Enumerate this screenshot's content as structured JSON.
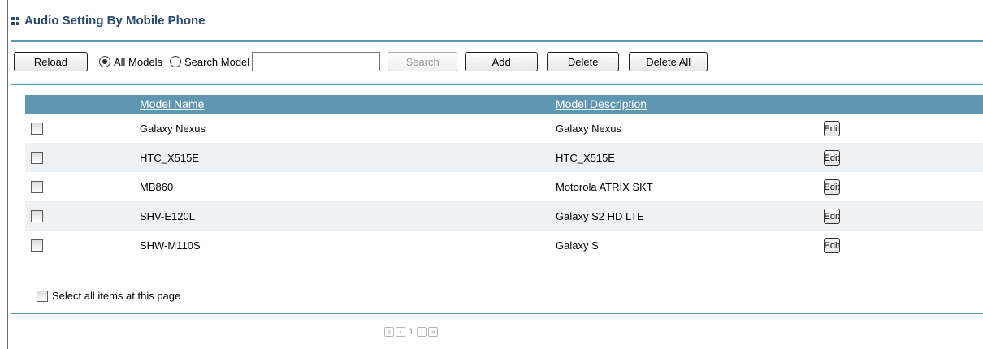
{
  "title": "Audio Setting By Mobile Phone",
  "toolbar": {
    "reload_label": "Reload",
    "all_models_label": "All Models",
    "search_model_label": "Search Model",
    "search_input_value": "",
    "search_label": "Search",
    "add_label": "Add",
    "delete_label": "Delete",
    "delete_all_label": "Delete All",
    "selected_mode": "All Models"
  },
  "table": {
    "columns": [
      "Model Name",
      "Model Description"
    ],
    "edit_label": "Edit",
    "rows": [
      {
        "name": "Galaxy Nexus",
        "description": "Galaxy Nexus"
      },
      {
        "name": "HTC_X515E",
        "description": "HTC_X515E"
      },
      {
        "name": "MB860",
        "description": "Motorola ATRIX SKT"
      },
      {
        "name": "SHV-E120L",
        "description": "Galaxy S2 HD LTE"
      },
      {
        "name": "SHW-M110S",
        "description": "Galaxy S"
      }
    ]
  },
  "select_all_label": "Select all items at this page",
  "pager": {
    "current_page": "1",
    "first_symbol": "«",
    "prev_symbol": "‹",
    "next_symbol": "›",
    "last_symbol": "»"
  },
  "colors": {
    "accent": "#5a9bb4",
    "header_bg": "#5f97b3",
    "title": "#2b4a6f",
    "alt_row": "#eef2f4"
  }
}
